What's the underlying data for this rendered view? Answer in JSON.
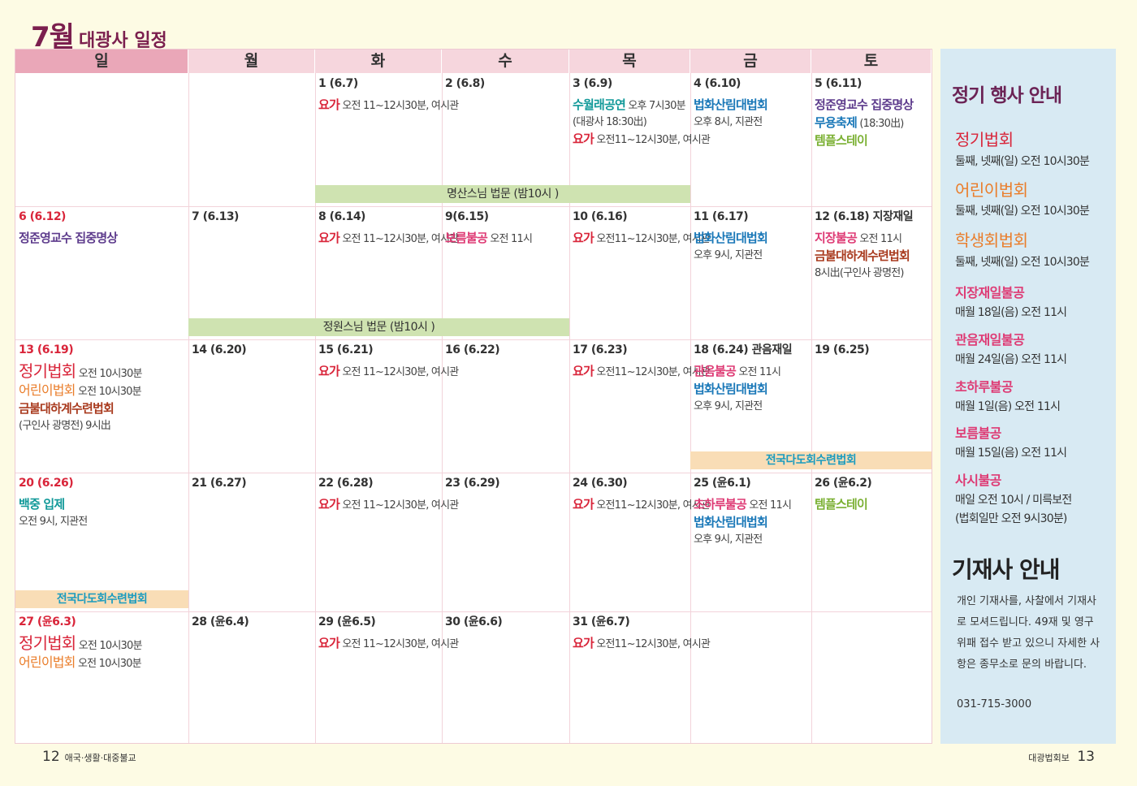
{
  "title": {
    "month": "7월",
    "rest": "대광사 일정"
  },
  "days": [
    "일",
    "월",
    "화",
    "수",
    "목",
    "금",
    "토"
  ],
  "cells": {
    "r0c2": {
      "date": "1 (6.7)",
      "ev1a": "요가",
      "ev1b": "오전 11~12시30분, 여시관"
    },
    "r0c3": {
      "date": "2 (6.8)"
    },
    "r0c4": {
      "date": "3 (6.9)",
      "ev1a": "수월래공연",
      "ev1b": "오후 7시30분",
      "ev2": "(대광사 18:30出)",
      "ev3a": "요가",
      "ev3b": "오전11~12시30분, 여시관"
    },
    "r0c5": {
      "date": "4 (6.10)",
      "ev1a": "법화산림대법회",
      "ev2": "오후 8시, 지관전"
    },
    "r0c6": {
      "date": "5 (6.11)",
      "ev1a": "정준영교수 집중명상",
      "ev2a": "무용축제",
      "ev2b": "(18:30出)",
      "ev3a": "템플스테이"
    },
    "r1c0": {
      "date": "6 (6.12)",
      "ev1a": "정준영교수 집중명상"
    },
    "r1c1": {
      "date": "7 (6.13)"
    },
    "r1c2": {
      "date": "8 (6.14)",
      "ev1a": "요가",
      "ev1b": "오전 11~12시30분, 여시관"
    },
    "r1c3": {
      "date": "9(6.15)",
      "ev1a": "보름불공",
      "ev1b": "오전 11시"
    },
    "r1c4": {
      "date": "10 (6.16)",
      "ev1a": "요가",
      "ev1b": "오전11~12시30분, 여시관"
    },
    "r1c5": {
      "date": "11 (6.17)",
      "ev1a": "법화산림대법회",
      "ev2": "오후 9시, 지관전"
    },
    "r1c6": {
      "date": "12 (6.18) 지장재일",
      "ev1a": "지장불공",
      "ev1b": "오전 11시",
      "ev2a": "금불대하계수련법회",
      "ev3": "8시出(구인사 광명전)"
    },
    "r2c0": {
      "date": "13 (6.19)",
      "ev1a": "정기법회",
      "ev1b": "오전 10시30분",
      "ev2a": "어린이법회",
      "ev2b": "오전 10시30분",
      "ev3a": "금불대하계수련법회",
      "ev4": "(구인사 광명전) 9시出"
    },
    "r2c1": {
      "date": "14 (6.20)"
    },
    "r2c2": {
      "date": "15 (6.21)",
      "ev1a": "요가",
      "ev1b": "오전 11~12시30분, 여시관"
    },
    "r2c3": {
      "date": "16 (6.22)"
    },
    "r2c4": {
      "date": "17 (6.23)",
      "ev1a": "요가",
      "ev1b": "오전11~12시30분, 여시관"
    },
    "r2c5": {
      "date": "18 (6.24) 관음재일",
      "ev1a": "관음불공",
      "ev1b": "오전 11시",
      "ev2a": "법화산림대법회",
      "ev3": "오후 9시, 지관전"
    },
    "r2c6": {
      "date": "19 (6.25)"
    },
    "r3c0": {
      "date": "20 (6.26)",
      "ev1a": "백중 입제",
      "ev2": "오전 9시, 지관전"
    },
    "r3c1": {
      "date": "21 (6.27)"
    },
    "r3c2": {
      "date": "22 (6.28)",
      "ev1a": "요가",
      "ev1b": "오전 11~12시30분, 여시관"
    },
    "r3c3": {
      "date": "23 (6.29)"
    },
    "r3c4": {
      "date": "24 (6.30)",
      "ev1a": "요가",
      "ev1b": "오전11~12시30분, 여시관"
    },
    "r3c5": {
      "date": "25 (윤6.1)",
      "ev1a": "초하루불공",
      "ev1b": "오전 11시",
      "ev2a": "법화산림대법회",
      "ev3": "오후 9시, 지관전"
    },
    "r3c6": {
      "date": "26 (윤6.2)",
      "ev1a": "템플스테이"
    },
    "r4c0": {
      "date": "27 (윤6.3)",
      "ev1a": "정기법회",
      "ev1b": "오전 10시30분",
      "ev2a": "어린이법회",
      "ev2b": "오전 10시30분"
    },
    "r4c1": {
      "date": "28 (윤6.4)"
    },
    "r4c2": {
      "date": "29 (윤6.5)",
      "ev1a": "요가",
      "ev1b": "오전 11~12시30분, 여시관"
    },
    "r4c3": {
      "date": "30 (윤6.6)"
    },
    "r4c4": {
      "date": "31 (윤6.7)",
      "ev1a": "요가",
      "ev1b": "오전11~12시30분, 여시관"
    }
  },
  "bars": {
    "b1": "명산스님 법문 (밤10시 )",
    "b2": "정원스님 법문 (밤10시 )",
    "b3": "전국다도회수련법회",
    "b4": "전국다도회수련법회"
  },
  "side": {
    "heading": "정기 행사 안내",
    "items": [
      {
        "name": "정기법회",
        "desc": "둘째, 넷째(일) 오전 10시30분",
        "color": "#d9253a"
      },
      {
        "name": "어린이법회",
        "desc": "둘째, 넷째(일) 오전 10시30분",
        "color": "#ea7d2a"
      },
      {
        "name": "학생회법회",
        "desc": "둘째, 넷째(일) 오전 10시30분",
        "color": "#ea7d2a"
      },
      {
        "name": "지장재일불공",
        "desc": "매월 18일(음) 오전 11시",
        "color": "#de3a74"
      },
      {
        "name": "관음재일불공",
        "desc": "매월 24일(음) 오전 11시",
        "color": "#de3a74"
      },
      {
        "name": "초하루불공",
        "desc": "매월 1일(음) 오전 11시",
        "color": "#de3a74"
      },
      {
        "name": "보름불공",
        "desc": "매월 15일(음) 오전 11시",
        "color": "#de3a74"
      },
      {
        "name": "사시불공",
        "desc": "매일 오전 10시 / 미륵보전",
        "desc2": "(법회일만 오전 9시30분)",
        "color": "#de3a74"
      }
    ],
    "heading2": "기재사 안내",
    "para": "개인 기재사를, 사찰에서 기재사로 모셔드립니다. 49재 및 영구위패 접수 받고 있으니 자세한 사항은 종무소로 문의 바랍니다.",
    "phone": "031-715-3000"
  },
  "footer": {
    "left_num": "12",
    "left_text": "애국·생활·대중불교",
    "right_text": "대광법회보",
    "right_num": "13"
  }
}
